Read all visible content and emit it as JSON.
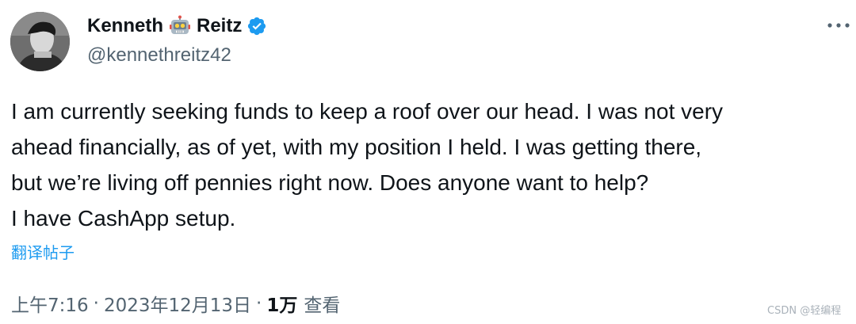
{
  "author": {
    "name_first": "Kenneth",
    "name_emoji_icon": "robot-face-icon",
    "name_last": "Reitz",
    "verified_icon": "verified-badge-icon",
    "handle": "@kennethreitz42"
  },
  "more_icon": "more-horizontal-icon",
  "tweet": {
    "lines": [
      "I am currently seeking funds to keep a roof over our head. I was not very",
      "ahead financially, as of yet, with my position I held. I was getting there,",
      "but we’re living off pennies right now. Does anyone want to help?",
      "I have CashApp setup."
    ],
    "translate_label": "翻译帖子"
  },
  "meta": {
    "time": "上午7:16",
    "separator": "·",
    "date": "2023年12月13日",
    "views_count": "1万",
    "views_label": "查看"
  },
  "watermark": "CSDN @轻编程",
  "colors": {
    "text": "#0f1419",
    "secondary": "#536471",
    "link": "#1d9bf0",
    "verified": "#1d9bf0"
  }
}
